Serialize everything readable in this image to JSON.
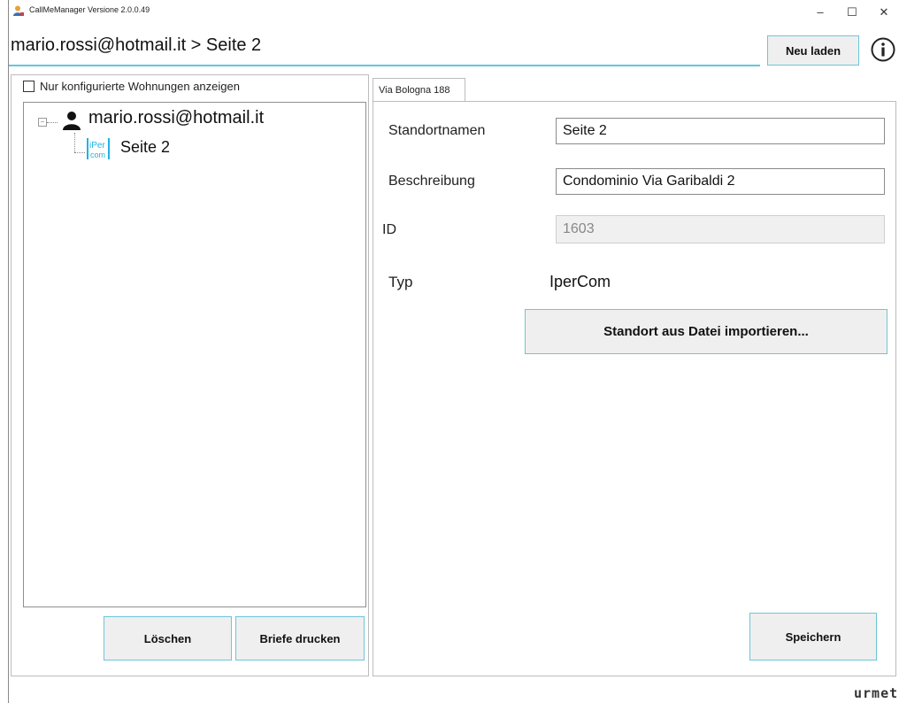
{
  "window": {
    "title": "CallMeManager Versione 2.0.0.49",
    "controls": {
      "minimize": "–",
      "maximize": "☐",
      "close": "✕"
    }
  },
  "header": {
    "breadcrumb": "mario.rossi@hotmail.it > Seite 2",
    "reload_label": "Neu laden",
    "info_icon": "info-icon"
  },
  "left": {
    "filter_checkbox_label": "Nur konfigurierte Wohnungen anzeigen",
    "filter_checked": false,
    "tree": {
      "root_label": "mario.rossi@hotmail.it",
      "child_label": "Seite 2",
      "child_icon_text": "iPer com"
    },
    "delete_label": "Löschen",
    "print_label": "Briefe drucken"
  },
  "right": {
    "tab_label": "Via Bologna 188",
    "fields": {
      "name_label": "Standortnamen",
      "name_value": "Seite 2",
      "description_label": "Beschreibung",
      "description_value": "Condominio Via Garibaldi 2",
      "id_label": "ID",
      "id_value": "1603",
      "type_label": "Typ",
      "type_value": "IperCom"
    },
    "import_label": "Standort aus Datei importieren...",
    "save_label": "Speichern"
  },
  "footer": {
    "brand": "urmet"
  },
  "colors": {
    "accent": "#5fc8dc",
    "ipercom": "#1fb3e0",
    "button_bg": "#efefef"
  }
}
